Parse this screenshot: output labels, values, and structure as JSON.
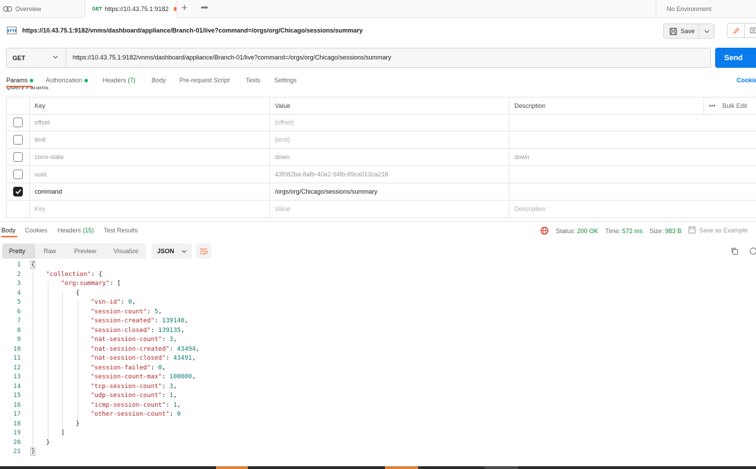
{
  "tabs": {
    "overview_label": "Overview",
    "active_method": "GET",
    "active_label": "https://10.43.75.1:9182",
    "plus_symbol": "+",
    "more_symbol": "•••"
  },
  "environment": {
    "label": "No Environment"
  },
  "request": {
    "title": "https://10.43.75.1:9182/vnms/dashboard/appliance/Branch-01/live?command=/orgs/org/Chicago/sessions/summary",
    "save_label": "Save",
    "method": "GET",
    "url": "https://10.43.75.1:9182/vnms/dashboard/appliance/Branch-01/live?command=/orgs/org/Chicago/sessions/summary",
    "send_label": "Send"
  },
  "request_tabs": {
    "params": "Params",
    "authorization": "Authorization",
    "headers": "Headers",
    "headers_count": "(7)",
    "body": "Body",
    "pre_request": "Pre-request Script",
    "tests": "Tests",
    "settings": "Settings",
    "cookies": "Cookie",
    "query_params_label": "Query Params"
  },
  "params_table": {
    "headers": {
      "key": "Key",
      "value": "Value",
      "description": "Description",
      "bulk_edit": "Bulk Edit",
      "more": "•••"
    },
    "rows": [
      {
        "key": "offset",
        "value": "{offset}",
        "description": "",
        "checked": false
      },
      {
        "key": "limit",
        "value": "{limit}",
        "description": "",
        "checked": false
      },
      {
        "key": "conn-state",
        "value": "down",
        "description": "down",
        "checked": false
      },
      {
        "key": "uuid",
        "value": "43f082ba-8afb-40a2-94fb-89ca013ca218",
        "description": "",
        "checked": false
      },
      {
        "key": "command",
        "value": "/orgs/org/Chicago/sessions/summary",
        "description": "",
        "checked": true
      }
    ],
    "placeholder": {
      "key": "Key",
      "value": "Value",
      "description": "Description"
    }
  },
  "response_tabs": {
    "body": "Body",
    "cookies": "Cookies",
    "headers": "Headers",
    "headers_count": "(15)",
    "test_results": "Test Results"
  },
  "response_status": {
    "status_label": "Status:",
    "status_value": "200 OK",
    "time_label": "Time:",
    "time_value": "572 ms",
    "size_label": "Size:",
    "size_value": "983 B",
    "save_example": "Save as Example"
  },
  "view_modes": {
    "pretty": "Pretty",
    "raw": "Raw",
    "preview": "Preview",
    "visualize": "Visualize",
    "format": "JSON"
  },
  "code_lines": [
    {
      "n": "1",
      "indent": 0,
      "parts": [
        [
          "p",
          "{"
        ]
      ]
    },
    {
      "n": "2",
      "indent": 1,
      "parts": [
        [
          "k",
          "\"collection\""
        ],
        [
          "p",
          ": {"
        ]
      ]
    },
    {
      "n": "3",
      "indent": 2,
      "parts": [
        [
          "k",
          "\"org:summary\""
        ],
        [
          "p",
          ": ["
        ]
      ]
    },
    {
      "n": "4",
      "indent": 3,
      "parts": [
        [
          "p",
          "{"
        ]
      ]
    },
    {
      "n": "5",
      "indent": 4,
      "parts": [
        [
          "k",
          "\"vsn-id\""
        ],
        [
          "p",
          ": "
        ],
        [
          "n",
          "0"
        ],
        [
          "p",
          ","
        ]
      ]
    },
    {
      "n": "6",
      "indent": 4,
      "parts": [
        [
          "k",
          "\"session-count\""
        ],
        [
          "p",
          ": "
        ],
        [
          "n",
          "5"
        ],
        [
          "p",
          ","
        ]
      ]
    },
    {
      "n": "7",
      "indent": 4,
      "parts": [
        [
          "k",
          "\"session-created\""
        ],
        [
          "p",
          ": "
        ],
        [
          "n",
          "139140"
        ],
        [
          "p",
          ","
        ]
      ]
    },
    {
      "n": "8",
      "indent": 4,
      "parts": [
        [
          "k",
          "\"session-closed\""
        ],
        [
          "p",
          ": "
        ],
        [
          "n",
          "139135"
        ],
        [
          "p",
          ","
        ]
      ]
    },
    {
      "n": "9",
      "indent": 4,
      "parts": [
        [
          "k",
          "\"nat-session-count\""
        ],
        [
          "p",
          ": "
        ],
        [
          "n",
          "3"
        ],
        [
          "p",
          ","
        ]
      ]
    },
    {
      "n": "10",
      "indent": 4,
      "parts": [
        [
          "k",
          "\"nat-session-created\""
        ],
        [
          "p",
          ": "
        ],
        [
          "n",
          "43494"
        ],
        [
          "p",
          ","
        ]
      ]
    },
    {
      "n": "11",
      "indent": 4,
      "parts": [
        [
          "k",
          "\"nat-session-closed\""
        ],
        [
          "p",
          ": "
        ],
        [
          "n",
          "43491"
        ],
        [
          "p",
          ","
        ]
      ]
    },
    {
      "n": "12",
      "indent": 4,
      "parts": [
        [
          "k",
          "\"session-failed\""
        ],
        [
          "p",
          ": "
        ],
        [
          "n",
          "0"
        ],
        [
          "p",
          ","
        ]
      ]
    },
    {
      "n": "13",
      "indent": 4,
      "parts": [
        [
          "k",
          "\"session-count-max\""
        ],
        [
          "p",
          ": "
        ],
        [
          "n",
          "100000"
        ],
        [
          "p",
          ","
        ]
      ]
    },
    {
      "n": "14",
      "indent": 4,
      "parts": [
        [
          "k",
          "\"tcp-session-count\""
        ],
        [
          "p",
          ": "
        ],
        [
          "n",
          "3"
        ],
        [
          "p",
          ","
        ]
      ]
    },
    {
      "n": "15",
      "indent": 4,
      "parts": [
        [
          "k",
          "\"udp-session-count\""
        ],
        [
          "p",
          ": "
        ],
        [
          "n",
          "1"
        ],
        [
          "p",
          ","
        ]
      ]
    },
    {
      "n": "16",
      "indent": 4,
      "parts": [
        [
          "k",
          "\"icmp-session-count\""
        ],
        [
          "p",
          ": "
        ],
        [
          "n",
          "1"
        ],
        [
          "p",
          ","
        ]
      ]
    },
    {
      "n": "17",
      "indent": 4,
      "parts": [
        [
          "k",
          "\"other-session-count\""
        ],
        [
          "p",
          ": "
        ],
        [
          "n",
          "0"
        ]
      ]
    },
    {
      "n": "18",
      "indent": 3,
      "parts": [
        [
          "p",
          "}"
        ]
      ]
    },
    {
      "n": "19",
      "indent": 2,
      "parts": [
        [
          "p",
          "]"
        ]
      ]
    },
    {
      "n": "20",
      "indent": 1,
      "parts": [
        [
          "p",
          "}"
        ]
      ]
    },
    {
      "n": "21",
      "indent": 0,
      "parts": [
        [
          "p",
          "}"
        ]
      ]
    }
  ],
  "colors": {
    "accent": "#ff6c37",
    "send_button": "#097bed",
    "json_key": "#b3262a",
    "json_number": "#0a7d6d",
    "status_ok": "#0b8a3a"
  }
}
